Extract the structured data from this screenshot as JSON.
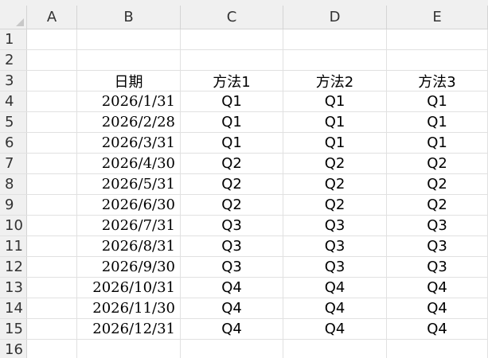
{
  "columns": [
    "A",
    "B",
    "C",
    "D",
    "E"
  ],
  "row_numbers": [
    "1",
    "2",
    "3",
    "4",
    "5",
    "6",
    "7",
    "8",
    "9",
    "10",
    "11",
    "12",
    "13",
    "14",
    "15",
    "16"
  ],
  "table": {
    "headers": [
      "日期",
      "方法1",
      "方法2",
      "方法3"
    ],
    "rows": [
      [
        "2026/1/31",
        "Q1",
        "Q1",
        "Q1"
      ],
      [
        "2026/2/28",
        "Q1",
        "Q1",
        "Q1"
      ],
      [
        "2026/3/31",
        "Q1",
        "Q1",
        "Q1"
      ],
      [
        "2026/4/30",
        "Q2",
        "Q2",
        "Q2"
      ],
      [
        "2026/5/31",
        "Q2",
        "Q2",
        "Q2"
      ],
      [
        "2026/6/30",
        "Q2",
        "Q2",
        "Q2"
      ],
      [
        "2026/7/31",
        "Q3",
        "Q3",
        "Q3"
      ],
      [
        "2026/8/31",
        "Q3",
        "Q3",
        "Q3"
      ],
      [
        "2026/9/30",
        "Q3",
        "Q3",
        "Q3"
      ],
      [
        "2026/10/31",
        "Q4",
        "Q4",
        "Q4"
      ],
      [
        "2026/11/30",
        "Q4",
        "Q4",
        "Q4"
      ],
      [
        "2026/12/31",
        "Q4",
        "Q4",
        "Q4"
      ]
    ]
  },
  "colors": {
    "header_bg": "#f0f0f0",
    "gridline": "#e1e1e1"
  }
}
